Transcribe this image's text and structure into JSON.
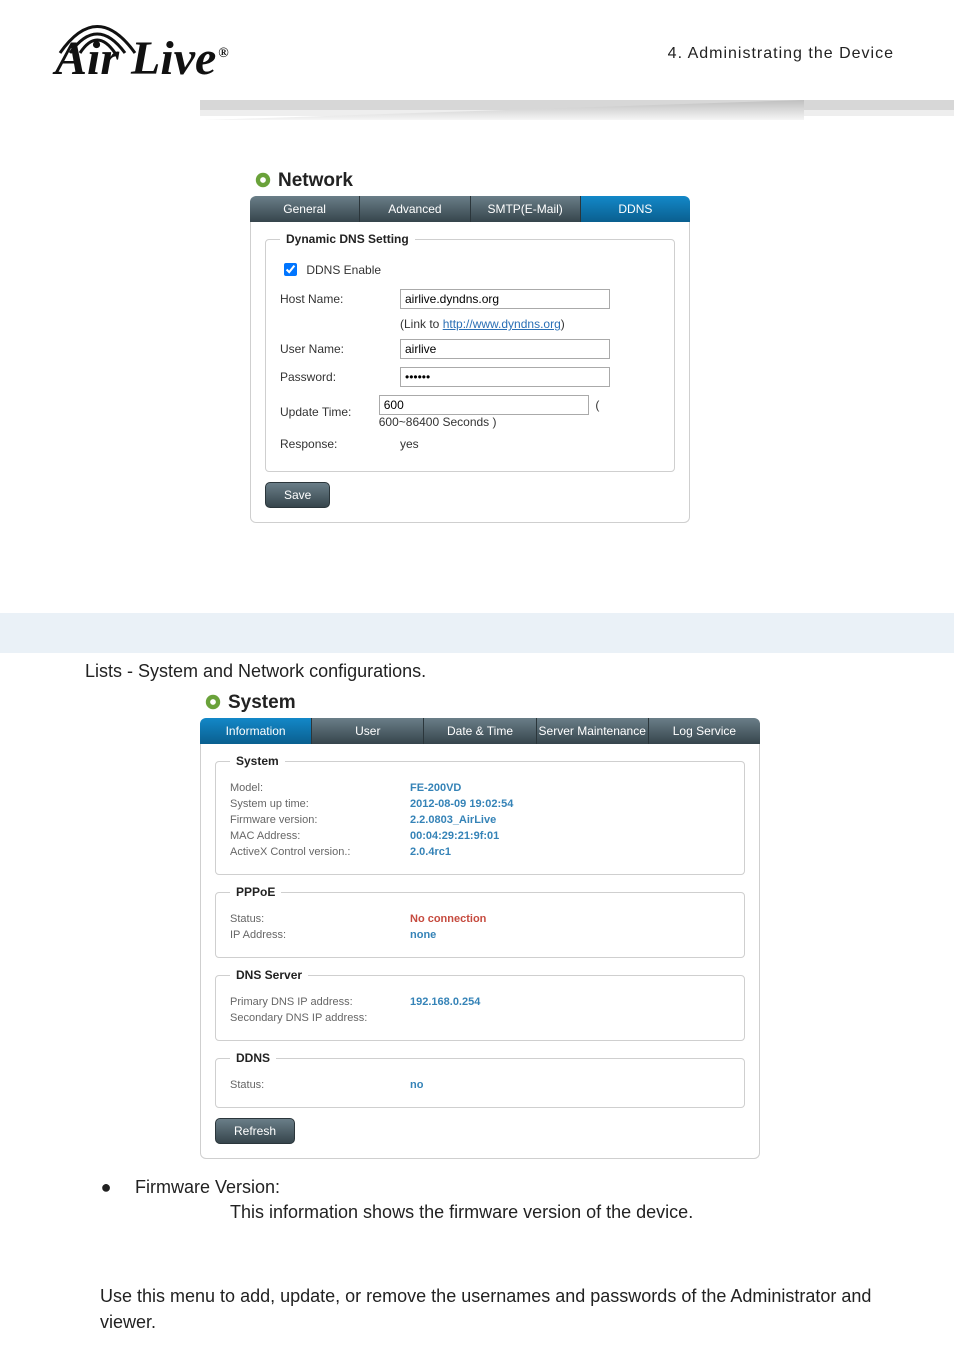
{
  "header": {
    "logo_text": "Air Live",
    "chapter": "4.  Administrating  the  Device"
  },
  "network_panel": {
    "title": "Network",
    "tabs": [
      {
        "label": "General",
        "active": false
      },
      {
        "label": "Advanced",
        "active": false
      },
      {
        "label": "SMTP(E-Mail)",
        "active": false
      },
      {
        "label": "DDNS",
        "active": true
      }
    ],
    "ddns": {
      "legend": "Dynamic DNS Setting",
      "enable_label": "DDNS Enable",
      "enable_checked": true,
      "host_name_label": "Host Name:",
      "host_name_value": "airlive.dyndns.org",
      "link_prefix": "(Link to ",
      "link_text": "http://www.dyndns.org",
      "link_suffix": ")",
      "user_name_label": "User Name:",
      "user_name_value": "airlive",
      "password_label": "Password:",
      "password_value": "••••••",
      "update_time_label": "Update Time:",
      "update_time_value": "600",
      "update_time_note": "( 600~86400 Seconds )",
      "response_label": "Response:",
      "response_value": "yes",
      "save_label": "Save"
    }
  },
  "lists_text": "Lists - System and Network configurations.",
  "system_panel": {
    "title": "System",
    "tabs": [
      {
        "label": "Information",
        "active": true
      },
      {
        "label": "User",
        "active": false
      },
      {
        "label": "Date & Time",
        "active": false
      },
      {
        "label": "Server Maintenance",
        "active": false
      },
      {
        "label": "Log Service",
        "active": false
      }
    ],
    "groups": [
      {
        "legend": "System",
        "rows": [
          {
            "label": "Model:",
            "value": "FE-200VD"
          },
          {
            "label": "System up time:",
            "value": "2012-08-09 19:02:54"
          },
          {
            "label": "Firmware version:",
            "value": "2.2.0803_AirLive"
          },
          {
            "label": "MAC Address:",
            "value": "00:04:29:21:9f:01"
          },
          {
            "label": "ActiveX Control version.:",
            "value": "2.0.4rc1"
          }
        ]
      },
      {
        "legend": "PPPoE",
        "rows": [
          {
            "label": "Status:",
            "value": "No connection",
            "red": true
          },
          {
            "label": "IP Address:",
            "value": "none"
          }
        ]
      },
      {
        "legend": "DNS Server",
        "rows": [
          {
            "label": "Primary DNS IP address:",
            "value": "192.168.0.254"
          },
          {
            "label": "Secondary DNS IP address:",
            "value": ""
          }
        ]
      },
      {
        "legend": "DDNS",
        "rows": [
          {
            "label": "Status:",
            "value": "no"
          }
        ]
      }
    ],
    "refresh_label": "Refresh"
  },
  "bullet": {
    "title": "Firmware Version:",
    "desc": "This information shows the firmware version of the device."
  },
  "paragraph": "Use this menu to add, update, or remove the usernames and passwords of the Administrator and viewer."
}
